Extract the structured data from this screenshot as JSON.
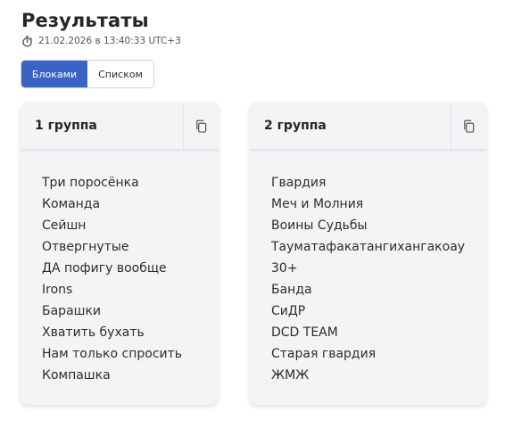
{
  "header": {
    "title": "Результаты",
    "timestamp_icon": "stopwatch-icon",
    "timestamp": "21.02.2026 в 13:40:33 UTC+3"
  },
  "view_toggle": {
    "selected": "Блоками",
    "options": [
      "Блоками",
      "Списком"
    ]
  },
  "accent_color": "#3b63c4",
  "groups": [
    {
      "title": "1 группа",
      "copy_icon": "copy-icon",
      "teams": [
        "Три поросёнка",
        "Команда",
        "Сейшн",
        "Отвергнутые",
        "ДА пофигу вообще",
        "Irons",
        "Барашки",
        "Хватить бухать",
        "Нам только спросить",
        "Компашка"
      ]
    },
    {
      "title": "2 группа",
      "copy_icon": "copy-icon",
      "teams": [
        "Гвардия",
        "Меч и Молния",
        "Воины Судьбы",
        "Тауматафакатангихангакоау",
        "30+",
        "Банда",
        "СиДР",
        "DCD TEAM",
        "Старая гвардия",
        "ЖМЖ"
      ]
    }
  ]
}
